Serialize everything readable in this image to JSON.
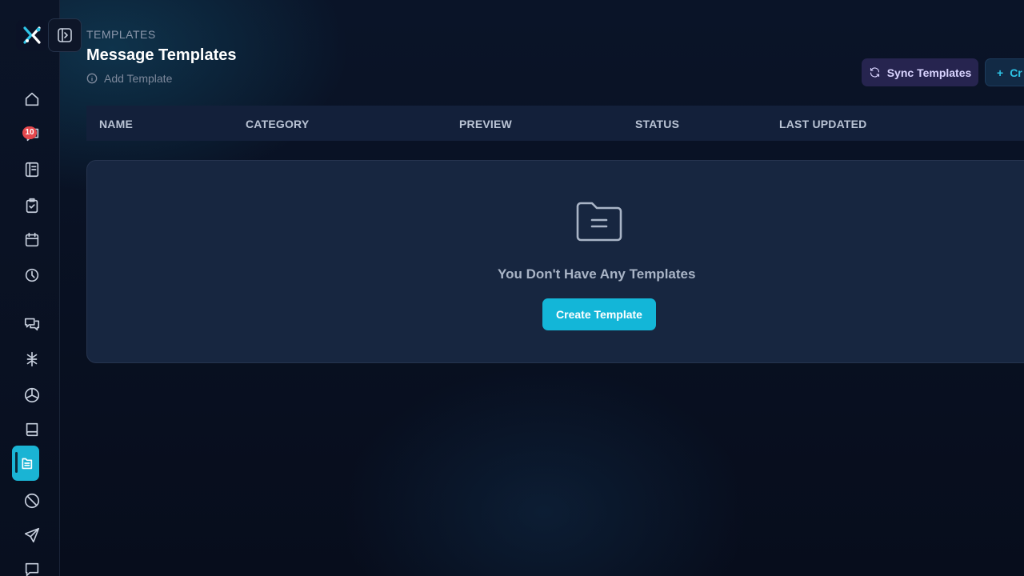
{
  "sidebar": {
    "logo_icon": "brand-logo-icon",
    "collapse_icon": "panel-expand-icon",
    "items": [
      {
        "icon": "home-icon"
      },
      {
        "icon": "chat-bubble-icon",
        "badge": "10"
      },
      {
        "icon": "notebook-icon"
      },
      {
        "icon": "clipboard-check-icon"
      },
      {
        "icon": "calendar-icon"
      },
      {
        "icon": "clock-icon"
      },
      {
        "icon": "messages-icon"
      },
      {
        "icon": "split-icon"
      },
      {
        "icon": "aperture-icon"
      },
      {
        "icon": "book-icon"
      },
      {
        "icon": "templates-icon",
        "active": true
      },
      {
        "icon": "block-icon"
      },
      {
        "icon": "send-icon"
      },
      {
        "icon": "message-square-icon"
      }
    ]
  },
  "header": {
    "eyebrow": "TEMPLATES",
    "title": "Message Templates",
    "add_template_label": "Add Template",
    "sync_label": "Sync Templates",
    "create_label_partial": "Cr"
  },
  "table": {
    "columns": [
      "NAME",
      "CATEGORY",
      "PREVIEW",
      "STATUS",
      "LAST UPDATED"
    ]
  },
  "empty_state": {
    "icon": "folder-icon",
    "message": "You Don't Have Any Templates",
    "button_label": "Create Template"
  },
  "colors": {
    "accent": "#13b6d8",
    "sync_button_bg": "#26244f",
    "badge": "#e5484d",
    "background": "#070d1c"
  }
}
